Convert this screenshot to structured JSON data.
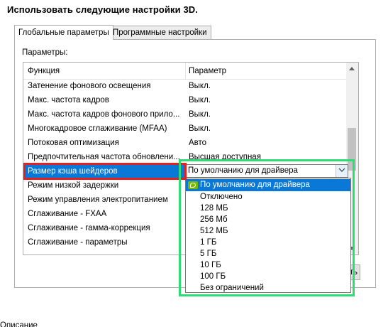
{
  "heading": "Использовать следующие настройки 3D.",
  "tabs": [
    {
      "label": "Глобальные параметры",
      "active": true
    },
    {
      "label": "Программные настройки",
      "active": false
    }
  ],
  "params_label": "Параметры:",
  "grid": {
    "header": {
      "function": "Функция",
      "parameter": "Параметр"
    },
    "rows": [
      {
        "function": "Затенение фонового освещения",
        "parameter": "Выкл."
      },
      {
        "function": "Макс. частота кадров",
        "parameter": "Выкл."
      },
      {
        "function": "Макс. частота кадров фонового прило...",
        "parameter": "Выкл."
      },
      {
        "function": "Многокадровое сглаживание (MFAA)",
        "parameter": "Выкл."
      },
      {
        "function": "Потоковая оптимизация",
        "parameter": "Авто"
      },
      {
        "function": "Предпочтительная частота обновлени...",
        "parameter": "Высшая доступная"
      },
      {
        "function": "Размер кэша шейдеров",
        "parameter": "",
        "selected": true
      },
      {
        "function": "Режим низкой задержки",
        "parameter": ""
      },
      {
        "function": "Режим управления электропитанием",
        "parameter": ""
      },
      {
        "function": "Сглаживание - FXAA",
        "parameter": ""
      },
      {
        "function": "Сглаживание - гамма-коррекция",
        "parameter": ""
      },
      {
        "function": "Сглаживание - параметры",
        "parameter": ""
      }
    ]
  },
  "combo": {
    "value": "По умолчанию для драйвера"
  },
  "dropdown": {
    "options": [
      {
        "label": "По умолчанию для драйвера",
        "highlighted": true,
        "icon": "nvidia-icon"
      },
      {
        "label": "Отключено"
      },
      {
        "label": "128 МБ"
      },
      {
        "label": "256 Мб"
      },
      {
        "label": "512 МБ"
      },
      {
        "label": "1 ГБ"
      },
      {
        "label": "5 ГБ"
      },
      {
        "label": "10 ГБ"
      },
      {
        "label": "100 ГБ"
      },
      {
        "label": "Без ограничений"
      }
    ]
  },
  "partial_button": {
    "label": "ть"
  },
  "bottom_label": "Описание",
  "colors": {
    "selection": "#0a78d7",
    "red_highlight": "#e32121",
    "green_highlight": "#2ddc73",
    "nvidia_green": "#76b900"
  }
}
